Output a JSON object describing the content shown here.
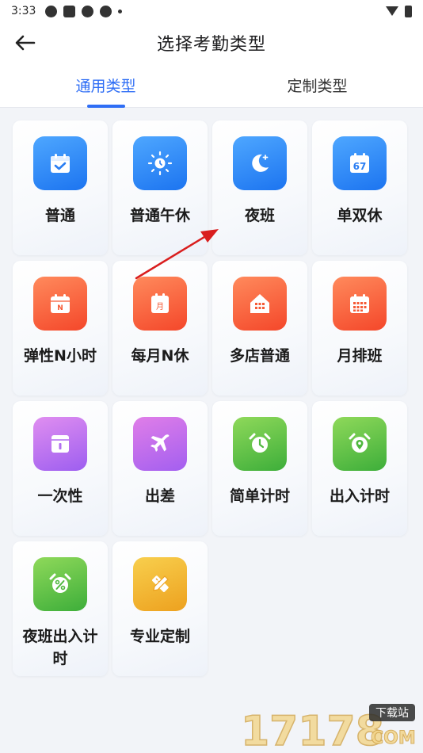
{
  "status_bar": {
    "time": "3:33"
  },
  "header": {
    "title": "选择考勤类型"
  },
  "tabs": [
    {
      "label": "通用类型",
      "active": true
    },
    {
      "label": "定制类型",
      "active": false
    }
  ],
  "types": [
    {
      "label": "普通",
      "icon": "calendar-check-icon",
      "color": "blue"
    },
    {
      "label": "普通午休",
      "icon": "sun-clock-icon",
      "color": "blue"
    },
    {
      "label": "夜班",
      "icon": "moon-icon",
      "color": "blue"
    },
    {
      "label": "单双休",
      "icon": "calendar-67-icon",
      "color": "blue",
      "badge": "67"
    },
    {
      "label": "弹性N小时",
      "icon": "calendar-n-icon",
      "color": "orange",
      "badge": "N"
    },
    {
      "label": "每月N休",
      "icon": "calendar-month-icon",
      "color": "orange",
      "badge": "月"
    },
    {
      "label": "多店普通",
      "icon": "store-icon",
      "color": "orange"
    },
    {
      "label": "月排班",
      "icon": "calendar-grid-icon",
      "color": "orange"
    },
    {
      "label": "一次性",
      "icon": "box-icon",
      "color": "purple"
    },
    {
      "label": "出差",
      "icon": "airplane-icon",
      "color": "purple2"
    },
    {
      "label": "简单计时",
      "icon": "alarm-clock-icon",
      "color": "green"
    },
    {
      "label": "出入计时",
      "icon": "location-clock-icon",
      "color": "green"
    },
    {
      "label": "夜班出入计时",
      "icon": "percent-clock-icon",
      "color": "green"
    },
    {
      "label": "专业定制",
      "icon": "ruler-pencil-icon",
      "color": "gold"
    }
  ],
  "watermark": {
    "number": "17178",
    "site": "下载站",
    "domain": "COM"
  }
}
